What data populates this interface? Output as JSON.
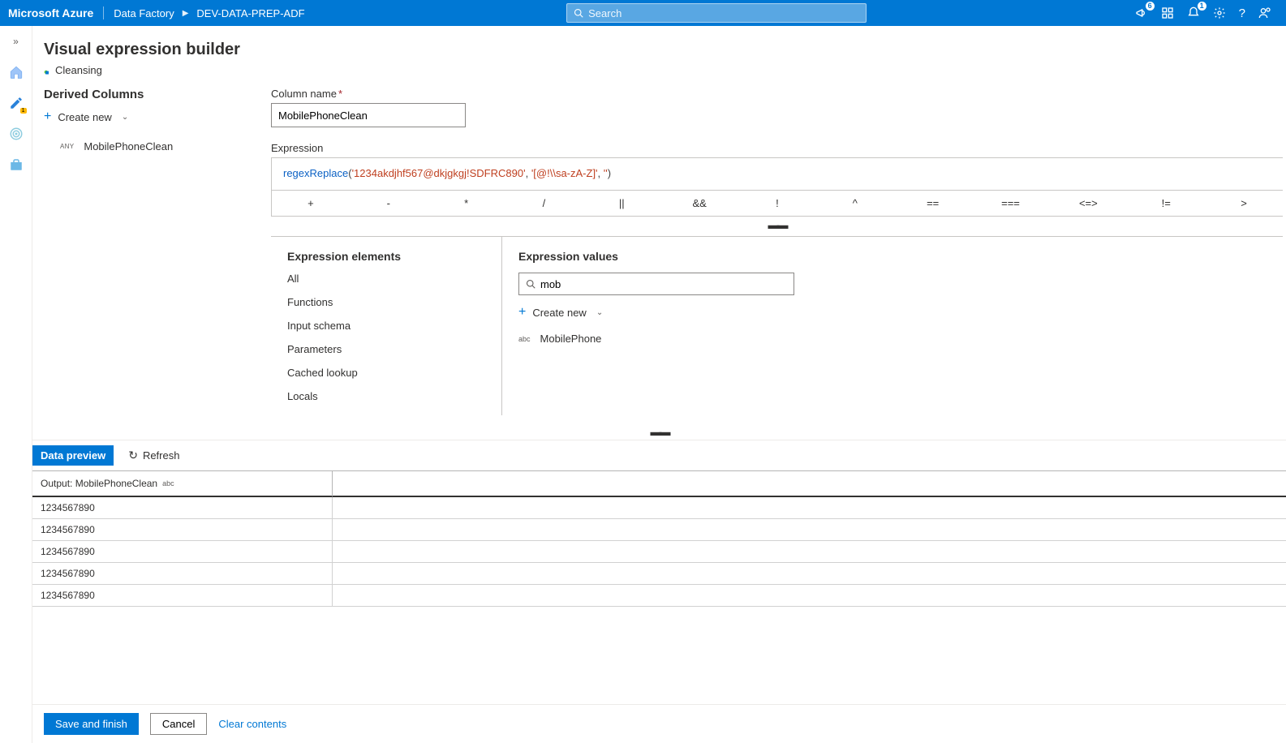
{
  "header": {
    "brand": "Microsoft Azure",
    "crumb1": "Data Factory",
    "crumb2": "DEV-DATA-PREP-ADF",
    "searchPlaceholder": "Search",
    "notificationsBadge": "6",
    "bellBadge": "1"
  },
  "rail": {
    "pencilBadge": "1"
  },
  "page": {
    "title": "Visual expression builder",
    "stepName": "Cleansing",
    "derivedColumnsHeading": "Derived Columns",
    "createNew": "Create new",
    "columnTypePill": "ANY",
    "columnItem": "MobilePhoneClean"
  },
  "form": {
    "columnNameLabel": "Column name",
    "columnNameValue": "MobilePhoneClean",
    "expressionLabel": "Expression",
    "fnName": "regexReplace",
    "str1": "'1234akdjhf567@dkjgkgj!SDFRC890'",
    "str2": "'[@!\\\\sa-zA-Z]'",
    "str3": "''"
  },
  "operators": [
    "+",
    "-",
    "*",
    "/",
    "||",
    "&&",
    "!",
    "^",
    "==",
    "===",
    "<=>",
    "!=",
    ">"
  ],
  "elements": {
    "heading": "Expression elements",
    "items": [
      "All",
      "Functions",
      "Input schema",
      "Parameters",
      "Cached lookup",
      "Locals"
    ]
  },
  "values": {
    "heading": "Expression values",
    "searchValue": "mob",
    "createNew": "Create new",
    "resultType": "abc",
    "resultName": "MobilePhone"
  },
  "preview": {
    "tab": "Data preview",
    "refresh": "Refresh",
    "outputLabel": "Output: MobilePhoneClean",
    "outputType": "abc",
    "rows": [
      "1234567890",
      "1234567890",
      "1234567890",
      "1234567890",
      "1234567890"
    ]
  },
  "footer": {
    "save": "Save and finish",
    "cancel": "Cancel",
    "clear": "Clear contents"
  }
}
